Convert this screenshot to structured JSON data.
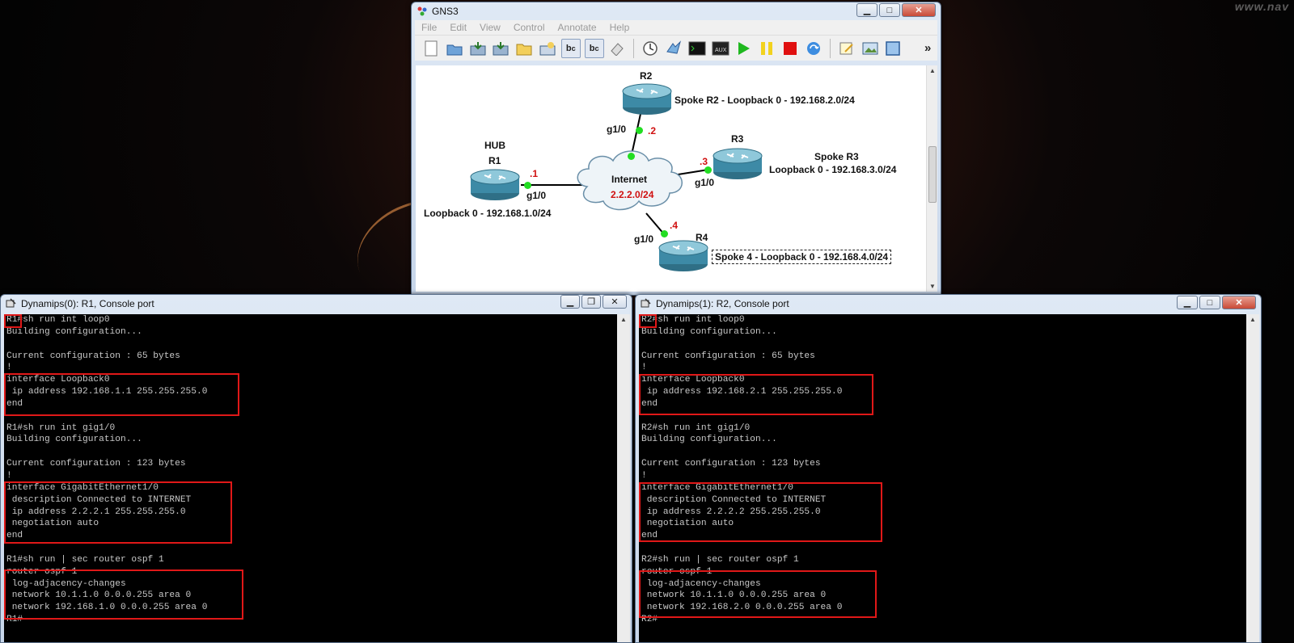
{
  "watermark": "www.nav",
  "gns3": {
    "title": "GNS3",
    "menu": [
      "File",
      "Edit",
      "View",
      "Control",
      "Annotate",
      "Help"
    ],
    "toolbar_icons": [
      "new-icon",
      "open-icon",
      "save-icon",
      "save-as-icon",
      "folder-icon",
      "snapshot-icon",
      "link-icon",
      "capture-icon",
      "eraser-icon",
      "clock-icon",
      "import-icon",
      "console-icon",
      "aux-icon",
      "start-icon",
      "suspend-icon",
      "stop-icon",
      "reload-icon",
      "note-icon",
      "image-icon",
      "rectangle-icon",
      "more-icon"
    ],
    "toolbar_more": "»",
    "topology": {
      "r2_name": "R2",
      "r2_desc": "Spoke R2 - Loopback 0 - 192.168.2.0/24",
      "r2_if": "g1/0",
      "r2_ip": ".2",
      "hub_label": "HUB",
      "r1_name": "R1",
      "r1_ip": ".1",
      "r1_if": "g1/0",
      "r1_desc": "Loopback 0 - 192.168.1.0/24",
      "internet_label": "Internet",
      "internet_net": "2.2.2.0/24",
      "r3_name": "R3",
      "r3_ip": ".3",
      "r3_if": "g1/0",
      "r3_desc1": "Spoke R3",
      "r3_desc2": "Loopback 0 - 192.168.3.0/24",
      "r4_ip": ".4",
      "r4_if": "g1/0",
      "r4_name": "R4",
      "r4_desc": "Spoke 4 - Loopback 0 - 192.168.4.0/24"
    }
  },
  "console1": {
    "title": "Dynamips(0): R1, Console port",
    "lines": [
      "R1#sh run int loop0",
      "Building configuration...",
      "",
      "Current configuration : 65 bytes",
      "!",
      "interface Loopback0",
      " ip address 192.168.1.1 255.255.255.0",
      "end",
      "",
      "R1#sh run int gig1/0",
      "Building configuration...",
      "",
      "Current configuration : 123 bytes",
      "!",
      "interface GigabitEthernet1/0",
      " description Connected to INTERNET",
      " ip address 2.2.2.1 255.255.255.0",
      " negotiation auto",
      "end",
      "",
      "R1#sh run | sec router ospf 1",
      "router ospf 1",
      " log-adjacency-changes",
      " network 10.1.1.0 0.0.0.255 area 0",
      " network 192.168.1.0 0.0.0.255 area 0",
      "R1#"
    ]
  },
  "console2": {
    "title": "Dynamips(1): R2, Console port",
    "lines": [
      "R2#sh run int loop0",
      "Building configuration...",
      "",
      "Current configuration : 65 bytes",
      "!",
      "interface Loopback0",
      " ip address 192.168.2.1 255.255.255.0",
      "end",
      "",
      "R2#sh run int gig1/0",
      "Building configuration...",
      "",
      "Current configuration : 123 bytes",
      "!",
      "interface GigabitEthernet1/0",
      " description Connected to INTERNET",
      " ip address 2.2.2.2 255.255.255.0",
      " negotiation auto",
      "end",
      "",
      "R2#sh run | sec router ospf 1",
      "router ospf 1",
      " log-adjacency-changes",
      " network 10.1.1.0 0.0.0.255 area 0",
      " network 192.168.2.0 0.0.0.255 area 0",
      "R2#"
    ]
  },
  "colors": {
    "highlight": "#e01818",
    "link_dot": "#22dd22",
    "ip_label": "#d01010"
  }
}
